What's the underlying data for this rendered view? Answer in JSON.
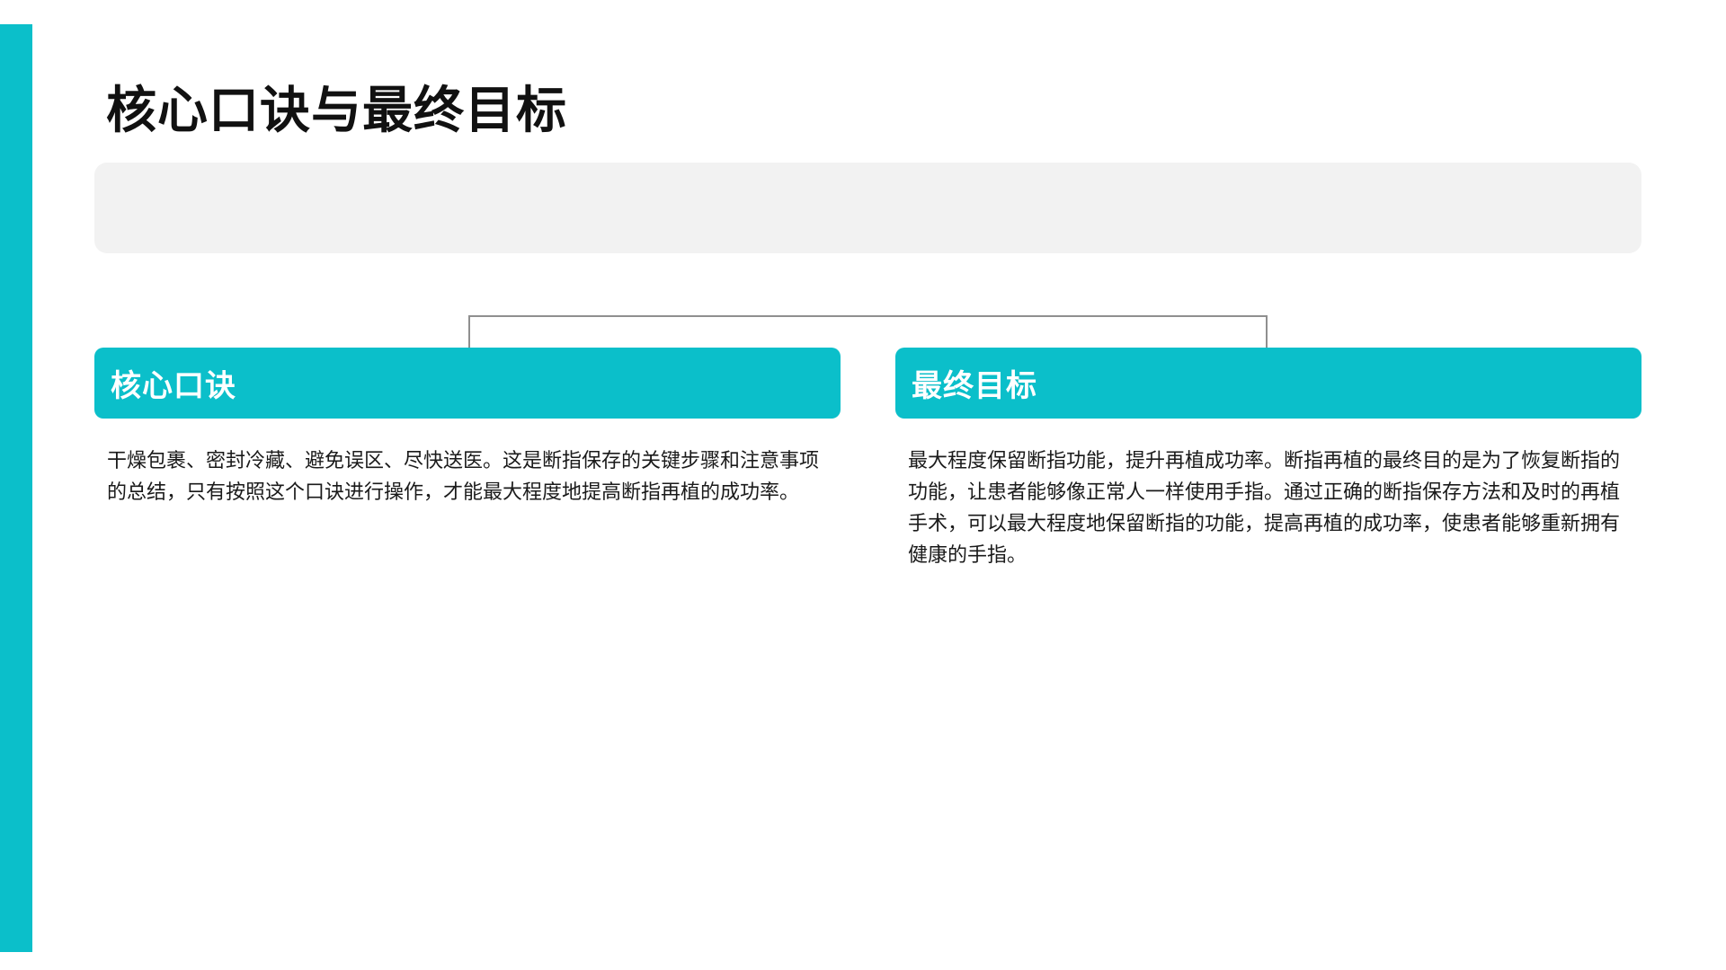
{
  "title": "核心口诀与最终目标",
  "cards": [
    {
      "heading": "核心口诀",
      "body": "干燥包裹、密封冷藏、避免误区、尽快送医。这是断指保存的关键步骤和注意事项的总结，只有按照这个口诀进行操作，才能最大程度地提高断指再植的成功率。"
    },
    {
      "heading": "最终目标",
      "body": "最大程度保留断指功能，提升再植成功率。断指再植的最终目的是为了恢复断指的功能，让患者能够像正常人一样使用手指。通过正确的断指保存方法和及时的再植手术，可以最大程度地保留断指的功能，提高再植的成功率，使患者能够重新拥有健康的手指。"
    }
  ],
  "colors": {
    "accent": "#0bbfca",
    "banner": "#f2f2f2",
    "text": "#1a1a1a"
  }
}
